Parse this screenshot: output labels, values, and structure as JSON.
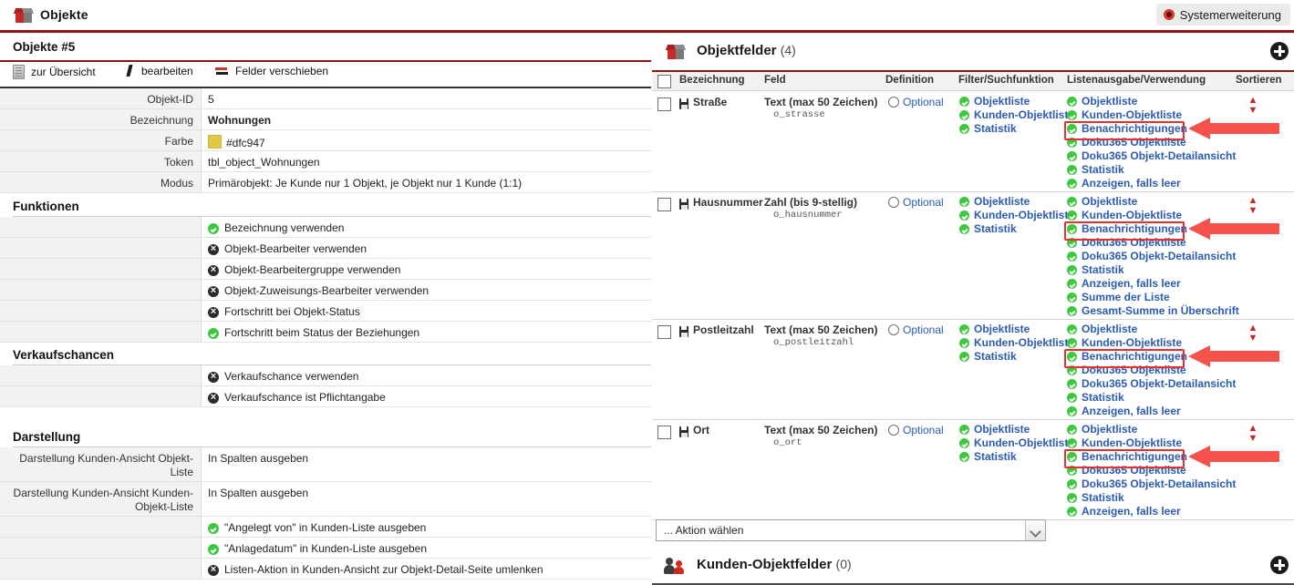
{
  "topbar": {
    "title": "Objekte",
    "icon": "box-icon",
    "system_button": {
      "label": "Systemerweiterung",
      "icon": "record-dot-icon"
    }
  },
  "left_panel": {
    "title": "Objekte #5",
    "toolbar": [
      {
        "label": "zur Übersicht",
        "icon": "list-icon"
      },
      {
        "label": "bearbeiten",
        "icon": "pencil-icon"
      },
      {
        "label": "Felder verschieben",
        "icon": "swap-arrows-icon"
      }
    ],
    "details": [
      {
        "key": "Objekt-ID",
        "value": "5",
        "style": "plain"
      },
      {
        "key": "Bezeichnung",
        "value": "Wohnungen",
        "style": "bold"
      },
      {
        "key": "Farbe",
        "value": "#dfc947",
        "style": "swatch",
        "color": "#dfc947"
      },
      {
        "key": "Token",
        "value": "tbl_object_Wohnungen",
        "style": "plain"
      },
      {
        "key": "Modus",
        "value": "Primärobjekt: Je Kunde nur 1 Objekt, je Objekt nur 1 Kunde (1:1)",
        "style": "plain"
      }
    ],
    "sections": [
      {
        "title": "Funktionen",
        "rows": [
          {
            "key": "",
            "label": "Bezeichnung verwenden",
            "state": "on"
          },
          {
            "key": "",
            "label": "Objekt-Bearbeiter verwenden",
            "state": "off"
          },
          {
            "key": "",
            "label": "Objekt-Bearbeitergruppe verwenden",
            "state": "off"
          },
          {
            "key": "",
            "label": "Objekt-Zuweisungs-Bearbeiter verwenden",
            "state": "off"
          },
          {
            "key": "",
            "label": "Fortschritt bei Objekt-Status",
            "state": "off"
          },
          {
            "key": "",
            "label": "Fortschritt beim Status der Beziehungen",
            "state": "on"
          }
        ]
      },
      {
        "title": "Verkaufschancen",
        "rows": [
          {
            "key": "",
            "label": "Verkaufschance verwenden",
            "state": "off"
          },
          {
            "key": "",
            "label": "Verkaufschance ist Pflichtangabe",
            "state": "off"
          }
        ]
      },
      {
        "title": "Darstellung",
        "rows": [
          {
            "key": "Darstellung Kunden-Ansicht Objekt-Liste",
            "label": "In Spalten ausgeben",
            "state": "text"
          },
          {
            "key": "Darstellung Kunden-Ansicht Kunden-Objekt-Liste",
            "label": "In Spalten ausgeben",
            "state": "text"
          },
          {
            "key": "",
            "label": "\"Angelegt von\" in Kunden-Liste ausgeben",
            "state": "on"
          },
          {
            "key": "",
            "label": "\"Anlagedatum\" in Kunden-Liste ausgeben",
            "state": "on"
          },
          {
            "key": "",
            "label": "Listen-Aktion in Kunden-Ansicht zur Objekt-Detail-Seite umlenken",
            "state": "off"
          }
        ]
      }
    ]
  },
  "right_panel": {
    "header": {
      "title": "Objektfelder",
      "count": "(4)",
      "icon": "box-icon",
      "add_button": "plus-icon"
    },
    "columns": [
      "Bezeichnung",
      "Feld",
      "Definition",
      "Filter/Suchfunktion",
      "Listenausgabe/Verwendung",
      "Sortieren"
    ],
    "rows": [
      {
        "name": "Straße",
        "field_type": "Text (max 50 Zeichen)",
        "token": "o_strasse",
        "definition": "Optional",
        "filter": [
          "Objektliste",
          "Kunden-Objektliste",
          "Statistik"
        ],
        "list_output": [
          "Objektliste",
          "Kunden-Objektliste",
          "Benachrichtigungen",
          "Doku365 Objektliste",
          "Doku365 Objekt-Detailansicht",
          "Statistik",
          "Anzeigen, falls leer"
        ],
        "highlighted_item": "Benachrichtigungen"
      },
      {
        "name": "Hausnummer",
        "field_type": "Zahl (bis 9-stellig)",
        "token": "o_hausnummer",
        "definition": "Optional",
        "filter": [
          "Objektliste",
          "Kunden-Objektliste",
          "Statistik"
        ],
        "list_output": [
          "Objektliste",
          "Kunden-Objektliste",
          "Benachrichtigungen",
          "Doku365 Objektliste",
          "Doku365 Objekt-Detailansicht",
          "Statistik",
          "Anzeigen, falls leer",
          "Summe der Liste",
          "Gesamt-Summe in Überschrift"
        ],
        "highlighted_item": "Benachrichtigungen"
      },
      {
        "name": "Postleitzahl",
        "field_type": "Text (max 50 Zeichen)",
        "token": "o_postleitzahl",
        "definition": "Optional",
        "filter": [
          "Objektliste",
          "Kunden-Objektliste",
          "Statistik"
        ],
        "list_output": [
          "Objektliste",
          "Kunden-Objektliste",
          "Benachrichtigungen",
          "Doku365 Objektliste",
          "Doku365 Objekt-Detailansicht",
          "Statistik",
          "Anzeigen, falls leer"
        ],
        "highlighted_item": "Benachrichtigungen"
      },
      {
        "name": "Ort",
        "field_type": "Text (max 50 Zeichen)",
        "token": "o_ort",
        "definition": "Optional",
        "filter": [
          "Objektliste",
          "Kunden-Objektliste",
          "Statistik"
        ],
        "list_output": [
          "Objektliste",
          "Kunden-Objektliste",
          "Benachrichtigungen",
          "Doku365 Objektliste",
          "Doku365 Objekt-Detailansicht",
          "Statistik",
          "Anzeigen, falls leer"
        ],
        "highlighted_item": "Benachrichtigungen"
      }
    ],
    "action_select": {
      "value": "... Aktion wählen"
    },
    "footer": {
      "title": "Kunden-Objektfelder",
      "count": "(0)",
      "icon": "people-icon",
      "add_button": "plus-icon"
    }
  },
  "colors": {
    "brand_red": "#8c1515",
    "accent_red": "#c32b2b",
    "link_blue": "#2b5bb7",
    "check_green": "#3ec83e",
    "highlight_red": "#e53030",
    "arrow_red": "#f4524a",
    "swatch_yellow": "#dfc947"
  }
}
